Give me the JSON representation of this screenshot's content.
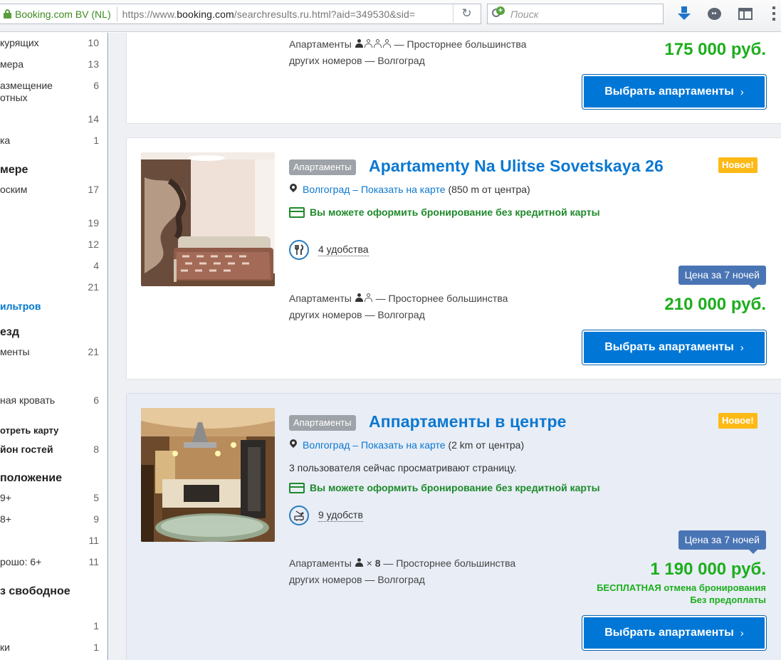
{
  "browser": {
    "site_identity": "Booking.com BV (NL)",
    "url_domain": "https://www.",
    "url_host": "booking.com",
    "url_path": "/searchresults.ru.html?aid=349530&sid=",
    "search_placeholder": "Поиск"
  },
  "sidebar": {
    "rows": [
      {
        "label": "курящих",
        "count": "10"
      },
      {
        "label": "мера",
        "count": "13"
      },
      {
        "label": "азмещение",
        "label2": "отных",
        "count": "6"
      },
      {
        "label": "",
        "count": "14"
      },
      {
        "label": "ка",
        "count": "1"
      },
      {
        "heading": "мере"
      },
      {
        "label": "оским",
        "count": "17"
      },
      {
        "label": "",
        "count": "19"
      },
      {
        "label": "",
        "count": "12"
      },
      {
        "label": "",
        "count": "4"
      },
      {
        "label": "",
        "count": "21"
      },
      {
        "link": "ильтров"
      },
      {
        "heading": "езд"
      },
      {
        "label": "менты",
        "count": "21"
      },
      {
        "label": "ная кровать",
        "count": "6"
      },
      {
        "smallbold": "отреть карту"
      },
      {
        "bold": "йон гостей",
        "count": "8"
      },
      {
        "heading": "положение"
      },
      {
        "label": "9+",
        "count": "5"
      },
      {
        "label": " 8+",
        "count": "9"
      },
      {
        "label": "",
        "count": "11"
      },
      {
        "label": "рошо: 6+",
        "count": "11"
      },
      {
        "heading": "з свободное"
      },
      {
        "label": "",
        "count": "1"
      },
      {
        "label": "ки",
        "count": "1"
      }
    ]
  },
  "listings": [
    {
      "room_desc_prefix": "Апартаменты",
      "room_desc_suffix": " — Просторнее большинства",
      "room_desc_line2": "других номеров — Волгоград",
      "price": "175 000 руб.",
      "button_label": "Выбрать апартаменты",
      "button_chevron": "›"
    },
    {
      "type_badge": "Апартаменты",
      "name": "Apartamenty Na Ulitse Sovetskaya 26",
      "new_badge": "Новое!",
      "location_link": "Волгоград – Показать на карте",
      "distance": "(850 m от центра)",
      "no_card_text": "Вы можете оформить бронирование без кредитной карты",
      "amenities": "4 удобства",
      "room_desc_prefix": "Апартаменты",
      "room_desc_suffix": " — Просторнее большинства",
      "room_desc_line2": "других номеров — Волгоград",
      "price_tag": "Цена за 7 ночей",
      "price": "210 000 руб.",
      "button_label": "Выбрать апартаменты",
      "button_chevron": "›"
    },
    {
      "type_badge": "Апартаменты",
      "name": "Аппартаменты в центре",
      "new_badge": "Новое!",
      "location_link": "Волгоград – Показать на карте",
      "distance": "(2 km от центра)",
      "viewers": "3 пользователя сейчас просматривают страницу.",
      "no_card_text": "Вы можете оформить бронирование без кредитной карты",
      "amenities": "9 удобств",
      "room_desc_prefix": "Апартаменты",
      "room_desc_mult": "× ",
      "room_desc_count": "8",
      "room_desc_suffix": " — Просторнее большинства",
      "room_desc_line2": "других номеров — Волгоград",
      "price_tag": "Цена за 7 ночей",
      "price": "1 190 000 руб.",
      "free_cancel": "БЕСПЛАТНАЯ отмена бронирования",
      "no_prepay": "Без предоплаты",
      "button_label": "Выбрать апартаменты",
      "button_chevron": "›"
    }
  ],
  "colors": {
    "link_blue": "#0b78d1",
    "price_green": "#1cae1c",
    "new_badge_yellow": "#fdb915",
    "button_blue": "#0077d6"
  }
}
